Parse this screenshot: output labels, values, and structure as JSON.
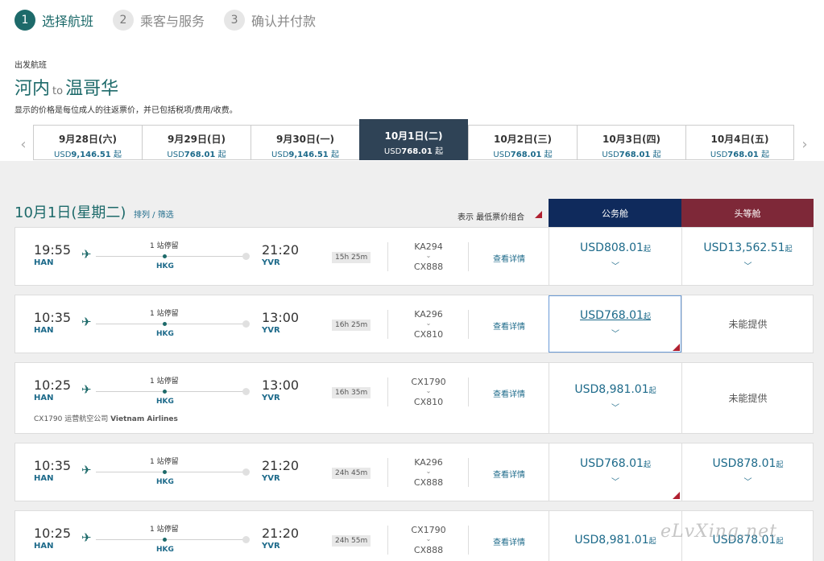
{
  "steps": [
    {
      "num": "1",
      "label": "选择航班"
    },
    {
      "num": "2",
      "label": "乘客与服务"
    },
    {
      "num": "3",
      "label": "确认并付款"
    }
  ],
  "route": {
    "sub": "出发航班",
    "origin": "河内",
    "to": "to",
    "dest": "温哥华",
    "note": "显示的价格是每位成人的往返票价，并已包括税项/费用/收费。"
  },
  "dates": [
    {
      "date": "9月28日(六)",
      "ccy": "USD",
      "amount": "9,146.51",
      "suffix": " 起"
    },
    {
      "date": "9月29日(日)",
      "ccy": "USD",
      "amount": "768.01",
      "suffix": " 起"
    },
    {
      "date": "9月30日(一)",
      "ccy": "USD",
      "amount": "9,146.51",
      "suffix": " 起"
    },
    {
      "date": "10月1日(二)",
      "ccy": "USD",
      "amount": "768.01",
      "suffix": " 起"
    },
    {
      "date": "10月2日(三)",
      "ccy": "USD",
      "amount": "768.01",
      "suffix": " 起"
    },
    {
      "date": "10月3日(四)",
      "ccy": "USD",
      "amount": "768.01",
      "suffix": " 起"
    },
    {
      "date": "10月4日(五)",
      "ccy": "USD",
      "amount": "768.01",
      "suffix": " 起"
    }
  ],
  "list": {
    "title": "10月1日(星期二)",
    "sort": "排列 / 筛选",
    "show": "表示 最低票价组合",
    "cabin_biz": "公务舱",
    "cabin_first": "头等舱",
    "details": "查看详情",
    "stop": "1 站停留",
    "not_available": "未能提供"
  },
  "flights": [
    {
      "dep": "19:55",
      "dep_code": "HAN",
      "stop_code": "HKG",
      "arr": "21:20",
      "arr_code": "YVR",
      "duration": "15h 25m",
      "f1": "KA294",
      "f2": "CX888",
      "operated": "",
      "biz_ccy": "USD",
      "biz_amt": "808.01",
      "biz_qi": "起",
      "first_ccy": "USD",
      "first_amt": "13,562.51",
      "first_qi": "起",
      "first_na": ""
    },
    {
      "dep": "10:35",
      "dep_code": "HAN",
      "stop_code": "HKG",
      "arr": "13:00",
      "arr_code": "YVR",
      "duration": "16h 25m",
      "f1": "KA296",
      "f2": "CX810",
      "operated": "",
      "biz_ccy": "USD",
      "biz_amt": "768.01",
      "biz_qi": "起",
      "first_ccy": "",
      "first_amt": "",
      "first_qi": "",
      "first_na": "未能提供"
    },
    {
      "dep": "10:25",
      "dep_code": "HAN",
      "stop_code": "HKG",
      "arr": "13:00",
      "arr_code": "YVR",
      "duration": "16h 35m",
      "f1": "CX1790",
      "f2": "CX810",
      "operated_pre": "CX1790 运营航空公司 ",
      "operated": "Vietnam Airlines",
      "biz_ccy": "USD",
      "biz_amt": "8,981.01",
      "biz_qi": "起",
      "first_ccy": "",
      "first_amt": "",
      "first_qi": "",
      "first_na": "未能提供"
    },
    {
      "dep": "10:35",
      "dep_code": "HAN",
      "stop_code": "HKG",
      "arr": "21:20",
      "arr_code": "YVR",
      "duration": "24h 45m",
      "f1": "KA296",
      "f2": "CX888",
      "operated": "",
      "biz_ccy": "USD",
      "biz_amt": "768.01",
      "biz_qi": "起",
      "first_ccy": "USD",
      "first_amt": "878.01",
      "first_qi": "起",
      "first_na": ""
    },
    {
      "dep": "10:25",
      "dep_code": "HAN",
      "stop_code": "HKG",
      "arr": "21:20",
      "arr_code": "YVR",
      "duration": "24h 55m",
      "f1": "CX1790",
      "f2": "CX888",
      "operated": "",
      "biz_ccy": "USD",
      "biz_amt": "8,981.01",
      "biz_qi": "起",
      "first_ccy": "USD",
      "first_amt": "878.01",
      "first_qi": "起",
      "first_na": ""
    }
  ],
  "watermark": "eLvXing.net",
  "colors": {
    "accent": "#1d6a6a",
    "business": "#0f2a5c",
    "first": "#7e2838",
    "link": "#1d6a8a",
    "active_date": "#2f4356"
  }
}
